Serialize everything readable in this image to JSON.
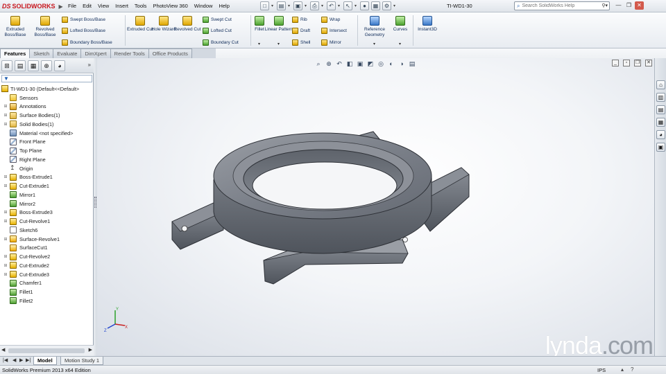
{
  "app": {
    "brand": "SOLIDWORKS",
    "brand_prefix": "DS",
    "document_title": "TI-WD1-30",
    "menus": [
      "File",
      "Edit",
      "View",
      "Insert",
      "Tools",
      "PhotoView 360",
      "Window",
      "Help"
    ],
    "help_search_placeholder": "Search SolidWorks Help"
  },
  "ribbon": {
    "extruded_boss": "Extruded Boss/Base",
    "revolved_boss": "Revolved Boss/Base",
    "swept_boss": "Swept Boss/Base",
    "lofted_boss": "Lofted Boss/Base",
    "boundary_boss": "Boundary Boss/Base",
    "extruded_cut": "Extruded Cut",
    "hole_wizard": "Hole Wizard",
    "revolved_cut": "Revolved Cut",
    "swept_cut": "Swept Cut",
    "lofted_cut": "Lofted Cut",
    "boundary_cut": "Boundary Cut",
    "fillet": "Fillet",
    "linear_pattern": "Linear Pattern",
    "rib": "Rib",
    "draft": "Draft",
    "shell": "Shell",
    "wrap": "Wrap",
    "intersect": "Intersect",
    "mirror": "Mirror",
    "reference_geometry": "Reference Geometry",
    "curves": "Curves",
    "instant3d": "Instant3D"
  },
  "tabs": [
    "Features",
    "Sketch",
    "Evaluate",
    "DimXpert",
    "Render Tools",
    "Office Products"
  ],
  "active_tab": "Features",
  "feature_tree": {
    "root": "TI-WD1-30  (Default<<Default>",
    "items": [
      {
        "label": "Sensors",
        "icon": "sensor-icon",
        "expandable": false
      },
      {
        "label": "Annotations",
        "icon": "annotations-icon",
        "expandable": true
      },
      {
        "label": "Surface Bodies(1)",
        "icon": "surface-bodies-folder-icon",
        "expandable": true
      },
      {
        "label": "Solid Bodies(1)",
        "icon": "solid-bodies-folder-icon",
        "expandable": true
      },
      {
        "label": "Material <not specified>",
        "icon": "material-icon",
        "expandable": false
      },
      {
        "label": "Front Plane",
        "icon": "plane-icon",
        "expandable": false
      },
      {
        "label": "Top Plane",
        "icon": "plane-icon",
        "expandable": false
      },
      {
        "label": "Right Plane",
        "icon": "plane-icon",
        "expandable": false
      },
      {
        "label": "Origin",
        "icon": "origin-icon",
        "expandable": false
      },
      {
        "label": "Boss-Extrude1",
        "icon": "boss-extrude-icon",
        "expandable": true
      },
      {
        "label": "Cut-Extrude1",
        "icon": "cut-extrude-icon",
        "expandable": true
      },
      {
        "label": "Mirror1",
        "icon": "mirror-icon",
        "expandable": false
      },
      {
        "label": "Mirror2",
        "icon": "mirror-icon",
        "expandable": false
      },
      {
        "label": "Boss-Extrude3",
        "icon": "boss-extrude-icon",
        "expandable": true
      },
      {
        "label": "Cut-Revolve1",
        "icon": "cut-revolve-icon",
        "expandable": true
      },
      {
        "label": "Sketch6",
        "icon": "sketch-icon",
        "expandable": false
      },
      {
        "label": "Surface-Revolve1",
        "icon": "surface-revolve-icon",
        "expandable": true
      },
      {
        "label": "SurfaceCut1",
        "icon": "surface-cut-icon",
        "expandable": false
      },
      {
        "label": "Cut-Revolve2",
        "icon": "cut-revolve-icon",
        "expandable": true
      },
      {
        "label": "Cut-Extrude2",
        "icon": "cut-extrude-icon",
        "expandable": true
      },
      {
        "label": "Cut-Extrude3",
        "icon": "cut-extrude-icon",
        "expandable": true
      },
      {
        "label": "Chamfer1",
        "icon": "chamfer-icon",
        "expandable": false
      },
      {
        "label": "Fillet1",
        "icon": "fillet-icon",
        "expandable": false
      },
      {
        "label": "Fillet2",
        "icon": "fillet-icon",
        "expandable": false
      }
    ]
  },
  "bottom_tabs": [
    "Model",
    "Motion Study 1"
  ],
  "active_bottom_tab": "Model",
  "status": {
    "edition": "SolidWorks Premium 2013 x64 Edition",
    "units": "IPS"
  },
  "watermark": {
    "text": "lynda",
    "suffix": ".com"
  },
  "colors": {
    "brand_red": "#c8161d",
    "model_gray": "#6b7079",
    "viewport_bg": "#f3f5f8"
  }
}
